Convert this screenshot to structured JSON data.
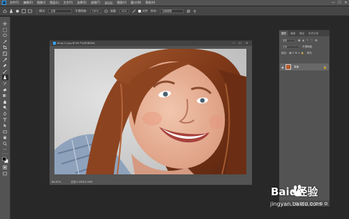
{
  "app": {
    "logo": "Ps",
    "menu": [
      "文件(F)",
      "编辑(E)",
      "图像(I)",
      "图层(L)",
      "文字(Y)",
      "选择(S)",
      "滤镜(T)",
      "3D(D)",
      "视图(V)",
      "窗口(W)",
      "帮助(H)"
    ],
    "window_controls": [
      "—",
      "☐",
      "✕"
    ]
  },
  "options_bar": {
    "feather_label": "模式:",
    "mode_value": "正常",
    "opacity_label": "不透明度:",
    "opacity_value": "100%",
    "flow_label": "流量:",
    "flow_value": "42%",
    "align_label": "对齐",
    "sample_label": "样本:",
    "sample_value": "当前图层"
  },
  "document": {
    "tab_title": "timg (1).jpg @ 66.7%(RGB/8#)",
    "zoom": "66.67%",
    "doc_info": "文档:2.09M/2.09M"
  },
  "panel": {
    "tabs": [
      "图层",
      "通道",
      "路径",
      "历史记录"
    ],
    "kind_label": "类型",
    "blend_mode": "正常",
    "opacity_label": "不透明度",
    "lock_label": "锁定:",
    "fill_label": "填充",
    "layer_name": "背景"
  },
  "watermark": {
    "brand": "Baid经验",
    "url": "jingyan.baidu.com"
  },
  "colors": {
    "accent": "#31a8ff",
    "chrome": "#535353",
    "background": "#282828"
  }
}
